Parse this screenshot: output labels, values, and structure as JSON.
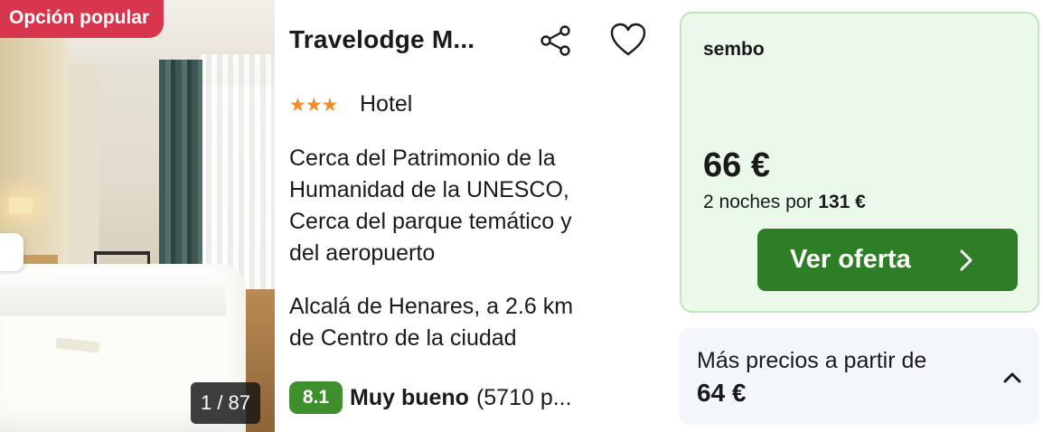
{
  "photo": {
    "badge": "Opción popular",
    "counter": "1 / 87"
  },
  "hotel": {
    "name": "Travelodge M...",
    "star_rating": 3,
    "stars": "★★★",
    "type": "Hotel",
    "description": "Cerca del Patrimonio de la\nHumanidad de la UNESCO,\nCerca del parque temático y\ndel aeropuerto",
    "location": "Alcalá de Henares, a 2.6 km\nde Centro de la ciudad",
    "score": "8.1",
    "rating_label": "Muy bueno",
    "reviews": "(5710 p..."
  },
  "deal": {
    "provider": "sembo",
    "price": "66 €",
    "total_prefix": "2 noches por",
    "total_value": "131 €",
    "cta_label": "Ver oferta"
  },
  "more_prices": {
    "label": "Más precios a partir de",
    "price": "64 €"
  },
  "colors": {
    "badge": "#d8364f",
    "stars": "#f08a2c",
    "score": "#3f8f2f",
    "cta": "#2e7d27",
    "deal_background": "#ebf9ea",
    "deal_border": "#bfe6bc",
    "more_background": "#f3f7fb"
  },
  "icons": {
    "share": "share-icon",
    "favorite": "heart-icon",
    "cta_arrow": "chevron-right-icon",
    "expand": "chevron-up-icon"
  }
}
